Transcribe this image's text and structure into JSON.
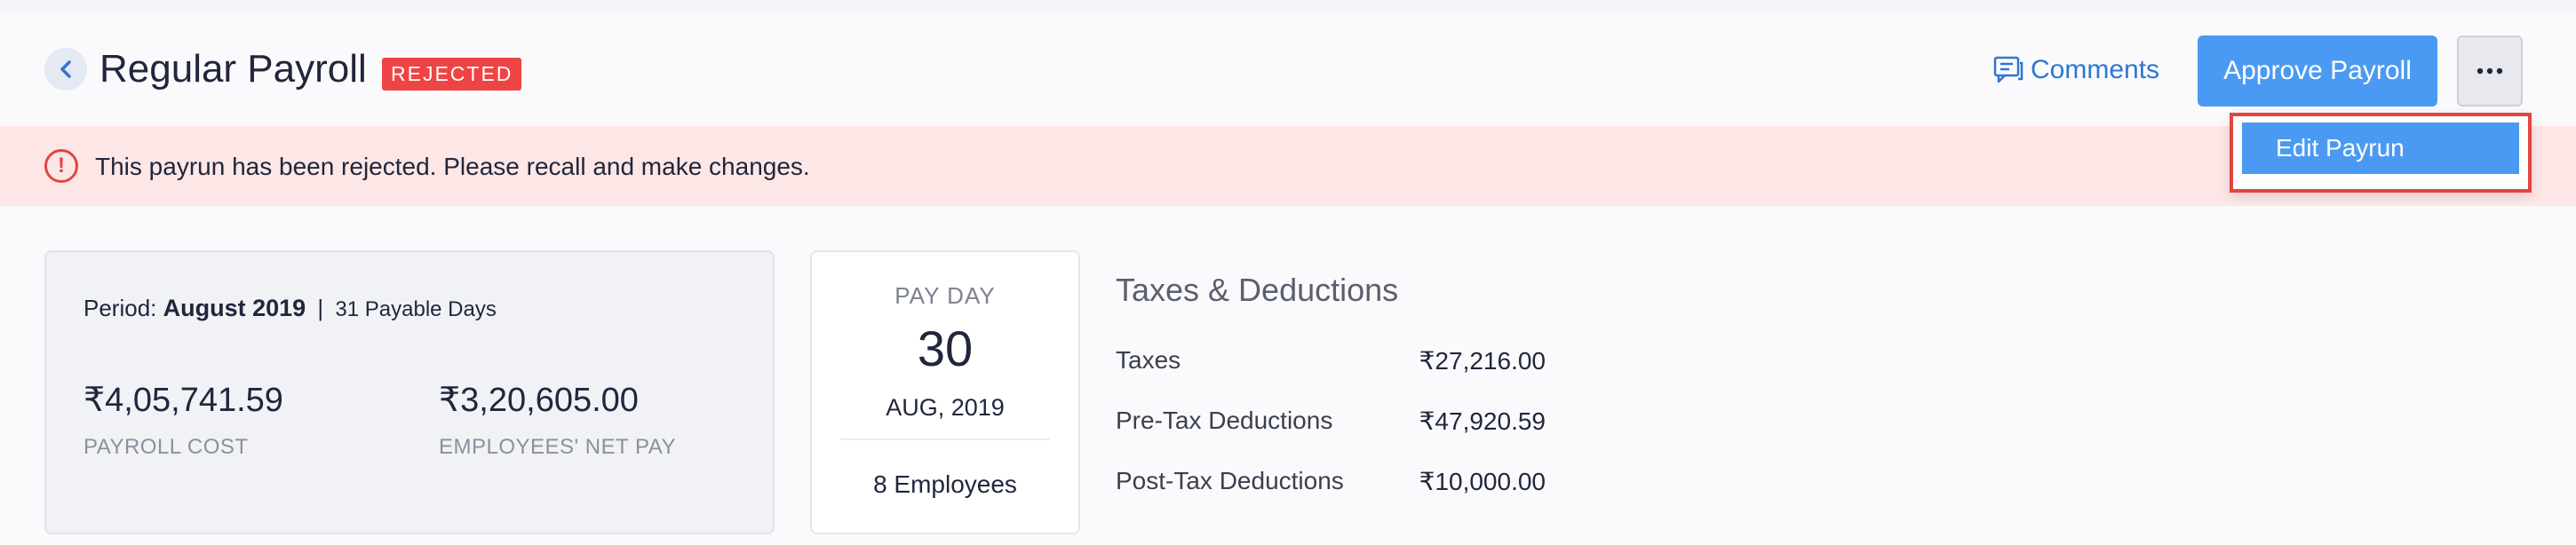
{
  "header": {
    "title": "Regular Payroll",
    "status": "REJECTED",
    "comments_label": "Comments",
    "approve_label": "Approve Payroll",
    "more_label": "•••"
  },
  "alert": {
    "icon": "!",
    "message": "This payrun has been rejected. Please recall and make changes."
  },
  "dropdown": {
    "items": [
      {
        "label": "Edit Payrun"
      }
    ]
  },
  "summary": {
    "period_label": "Period:",
    "period_value": "August 2019",
    "separator": "|",
    "payable_days": "31 Payable Days",
    "payroll_cost": "₹4,05,741.59",
    "payroll_cost_label": "PAYROLL COST",
    "net_pay": "₹3,20,605.00",
    "net_pay_label": "EMPLOYEES' NET PAY"
  },
  "payday": {
    "label": "PAY DAY",
    "day": "30",
    "month_year": "AUG, 2019",
    "employees": "8 Employees"
  },
  "taxes": {
    "title": "Taxes & Deductions",
    "rows": [
      {
        "label": "Taxes",
        "value": "₹27,216.00"
      },
      {
        "label": "Pre-Tax Deductions",
        "value": "₹47,920.59"
      },
      {
        "label": "Post-Tax Deductions",
        "value": "₹10,000.00"
      }
    ]
  },
  "colors": {
    "accent": "#4a9af3",
    "link": "#2f76d2",
    "danger": "#ef4444",
    "alert_bg": "#fde7e6"
  }
}
